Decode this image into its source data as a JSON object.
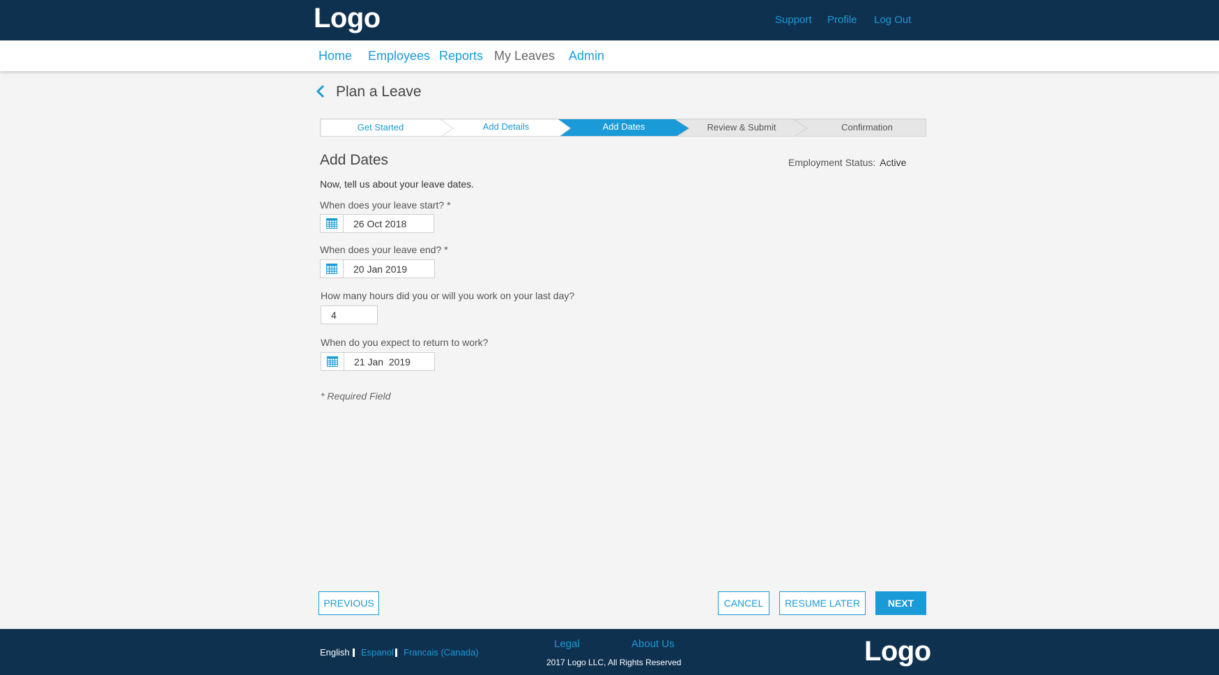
{
  "header": {
    "logo": "Logo",
    "links": {
      "support": "Support",
      "profile": "Profile",
      "logout": "Log Out"
    }
  },
  "nav": {
    "items": [
      {
        "label": "Home",
        "active": false
      },
      {
        "label": "Employees",
        "active": false
      },
      {
        "label": "Reports",
        "active": false
      },
      {
        "label": "My Leaves",
        "active": true
      },
      {
        "label": "Admin",
        "active": false
      }
    ]
  },
  "page": {
    "title": "Plan a Leave"
  },
  "stepper": {
    "steps": [
      {
        "label": "Get Started",
        "state": "completed"
      },
      {
        "label": "Add Details",
        "state": "completed"
      },
      {
        "label": "Add Dates",
        "state": "current"
      },
      {
        "label": "Review & Submit",
        "state": "upcoming"
      },
      {
        "label": "Confirmation",
        "state": "upcoming"
      }
    ]
  },
  "form": {
    "section_title": "Add Dates",
    "employment_status_label": "Employment Status:",
    "employment_status_value": "Active",
    "intro": "Now, tell us about your leave dates.",
    "leave_start": {
      "label": "When does your leave start? *",
      "value": "26 Oct 2018"
    },
    "leave_end": {
      "label": "When does your leave end? *",
      "value": "20 Jan 2019"
    },
    "hours_last_day": {
      "label": "How many hours did you or will you work on your last day?",
      "value": "4"
    },
    "return_date": {
      "label": "When do you expect to return to work?",
      "value": "21 Jan  2019"
    },
    "required_note": "* Required Field"
  },
  "actions": {
    "previous": "PREVIOUS",
    "cancel": "CANCEL",
    "resume_later": "RESUME LATER",
    "next": "NEXT"
  },
  "footer": {
    "languages": {
      "current": "English",
      "spanish": "Espanol",
      "french": "Francais (Canada)"
    },
    "links": {
      "legal": "Legal",
      "about": "About Us"
    },
    "copyright": "2017 Logo LLC, All Rights Reserved",
    "logo": "Logo"
  },
  "colors": {
    "header_bg": "#0f3150",
    "accent": "#1a9ad6",
    "upcoming_step": "#e6e6e6",
    "page_bg": "#f4f4f4"
  }
}
